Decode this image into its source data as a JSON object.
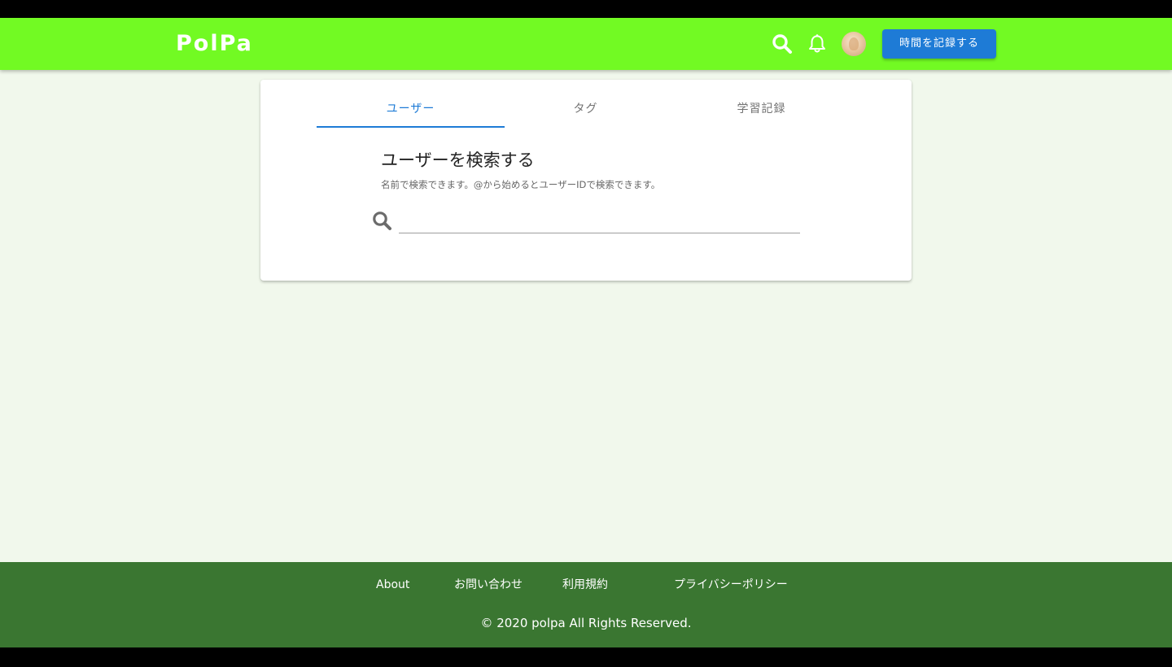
{
  "header": {
    "logo": "PolPa",
    "record_button_label": "時間を記録する",
    "icons": [
      "search-icon",
      "bell-icon",
      "avatar"
    ],
    "bar_color": "#72fa23",
    "button_color": "#1e7bd6"
  },
  "tabs": [
    {
      "label": "ユーザー",
      "active": true
    },
    {
      "label": "タグ",
      "active": false
    },
    {
      "label": "学習記録",
      "active": false
    }
  ],
  "search": {
    "title": "ユーザーを検索する",
    "description": "名前で検索できます。@から始めるとユーザーIDで検索できます。",
    "value": "",
    "placeholder": ""
  },
  "footer": {
    "links": [
      "About",
      "お問い合わせ",
      "利用規約",
      "プライバシーポリシー"
    ],
    "copyright": "© 2020 polpa All Rights Reserved.",
    "background_color": "#3a7631"
  },
  "page_background": "#f1f8ec"
}
